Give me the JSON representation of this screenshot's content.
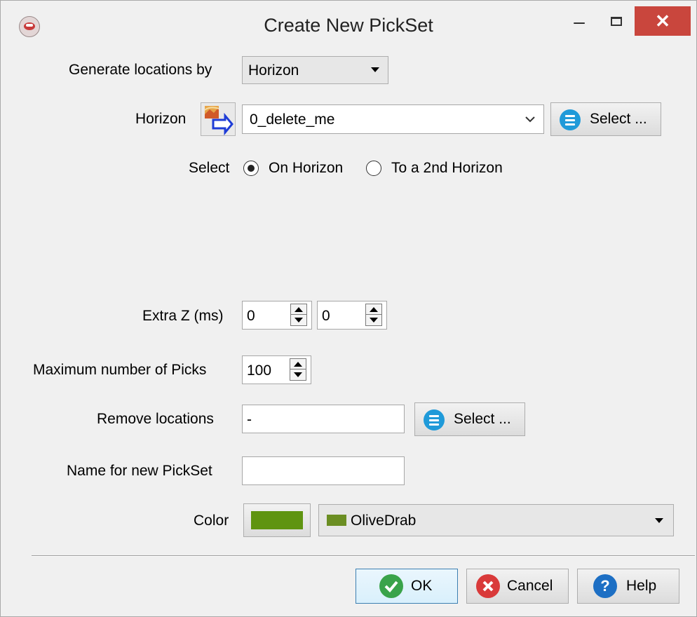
{
  "window": {
    "title": "Create New PickSet",
    "minimize_glyph": "–",
    "close_glyph": "✕"
  },
  "generate": {
    "label": "Generate locations by",
    "value": "Horizon"
  },
  "horizon": {
    "label": "Horizon",
    "value": "0_delete_me",
    "select_label": "Select ..."
  },
  "select_mode": {
    "label": "Select",
    "options": [
      "On Horizon",
      "To a 2nd Horizon"
    ],
    "selected": "On Horizon"
  },
  "extra_z": {
    "label": "Extra Z (ms)",
    "value1": "0",
    "value2": "0"
  },
  "max_picks": {
    "label": "Maximum number of Picks",
    "value": "100"
  },
  "remove_locations": {
    "label": "Remove locations",
    "value": "-",
    "select_label": "Select ..."
  },
  "pickset_name": {
    "label": "Name for new PickSet",
    "value": ""
  },
  "color": {
    "label": "Color",
    "name": "OliveDrab",
    "hex": "#6b8e23"
  },
  "footer": {
    "ok_label": "OK",
    "cancel_label": "Cancel",
    "help_label": "Help"
  },
  "colors": {
    "close_button": "#c9463d",
    "list_icon": "#1f9ad9",
    "ok_icon": "#3aa34a",
    "cancel_icon": "#d93a3a",
    "help_icon": "#1d6fc4"
  }
}
